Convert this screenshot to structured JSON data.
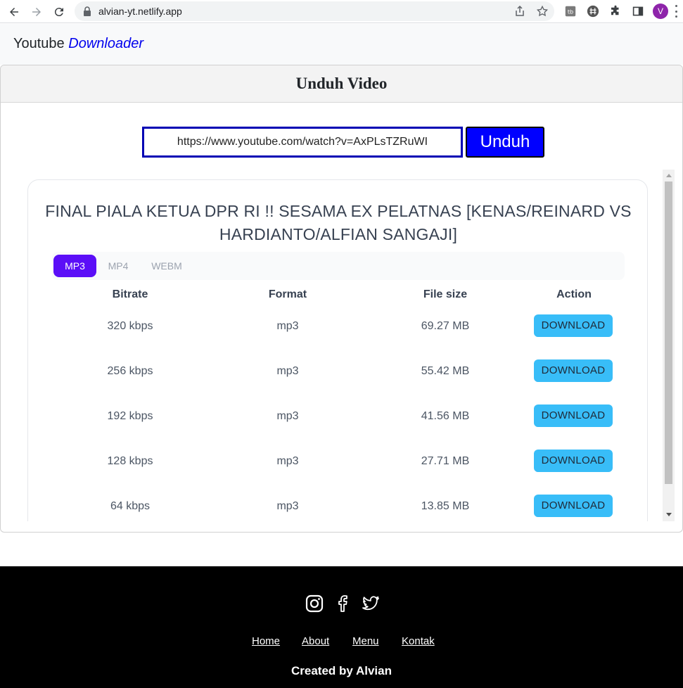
{
  "browser": {
    "url": "alvian-yt.netlify.app",
    "avatar_letter": "V"
  },
  "header": {
    "brand_plain": "Youtube",
    "brand_accent": "Downloader"
  },
  "card": {
    "title": "Unduh Video",
    "input_value": "https://www.youtube.com/watch?v=AxPLsTZRuWI",
    "submit_label": "Unduh"
  },
  "result": {
    "video_title": "FINAL PIALA KETUA DPR RI !! SESAMA EX PELATNAS [KENAS/REINARD VS HARDIANTO/ALFIAN SANGAJI]",
    "tabs": [
      {
        "label": "MP3",
        "active": true
      },
      {
        "label": "MP4",
        "active": false
      },
      {
        "label": "WEBM",
        "active": false
      }
    ],
    "columns": [
      "Bitrate",
      "Format",
      "File size",
      "Action"
    ],
    "rows": [
      {
        "bitrate": "320 kbps",
        "format": "mp3",
        "size": "69.27 MB",
        "action": "DOWNLOAD"
      },
      {
        "bitrate": "256 kbps",
        "format": "mp3",
        "size": "55.42 MB",
        "action": "DOWNLOAD"
      },
      {
        "bitrate": "192 kbps",
        "format": "mp3",
        "size": "41.56 MB",
        "action": "DOWNLOAD"
      },
      {
        "bitrate": "128 kbps",
        "format": "mp3",
        "size": "27.71 MB",
        "action": "DOWNLOAD"
      },
      {
        "bitrate": "64 kbps",
        "format": "mp3",
        "size": "13.85 MB",
        "action": "DOWNLOAD"
      }
    ]
  },
  "footer": {
    "social_icons": [
      "instagram-icon",
      "facebook-icon",
      "twitter-icon"
    ],
    "links": [
      "Home",
      "About",
      "Menu",
      "Kontak"
    ],
    "credit": "Created by Alvian"
  },
  "colors": {
    "brand_accent": "#0000ee",
    "input_border": "#0000b4",
    "unduh_button": "#0000ff",
    "active_tab": "#5b0ef7",
    "download_button": "#38bdf8",
    "footer_bg": "#000000"
  }
}
